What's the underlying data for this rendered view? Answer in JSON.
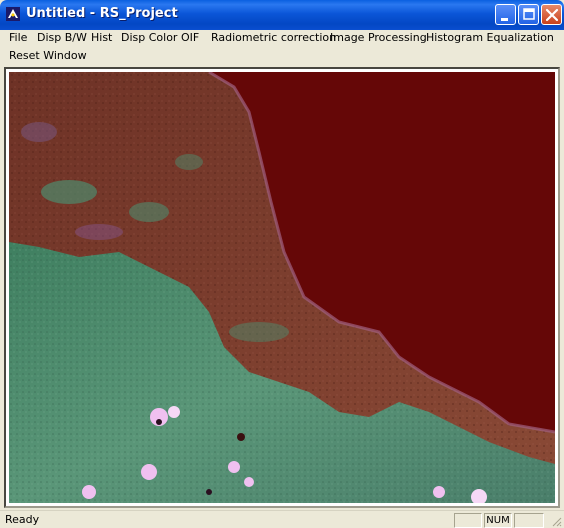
{
  "window": {
    "title": "Untitled - RS_Project"
  },
  "menu": {
    "items": [
      {
        "label": "File"
      },
      {
        "label": "Disp B/W"
      },
      {
        "label": "Hist"
      },
      {
        "label": "Disp Color"
      },
      {
        "label": "OIF"
      },
      {
        "label": "Radiometric correction"
      },
      {
        "label": "Image Processing"
      },
      {
        "label": "Histogram Equalization"
      },
      {
        "label": "Reset Window"
      }
    ]
  },
  "image": {
    "icon": "satellite-image",
    "colors": {
      "sea": "#650707",
      "land": "#7a3528",
      "vegetation": "#4f8a6a",
      "highlight": "#f0c0f0"
    }
  },
  "status": {
    "text": "Ready",
    "panes": [
      "",
      "NUM",
      ""
    ]
  },
  "colors": {
    "titlebar": "#0347c4",
    "chrome": "#ece9d8"
  }
}
